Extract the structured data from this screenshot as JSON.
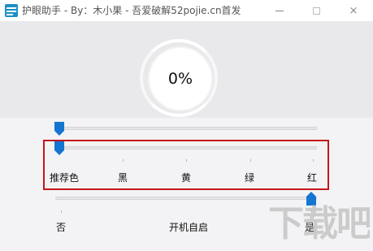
{
  "window": {
    "title": "护眼助手 - By：木小果 - 吾爱破解52pojie.cn首发",
    "minimize_icon": "minimize-icon",
    "maximize_icon": "maximize-icon",
    "close_label": "×"
  },
  "dial": {
    "value_text": "0%"
  },
  "sliders": {
    "brightness": {
      "value_fraction": 0.0
    },
    "color": {
      "options": [
        "推荐色",
        "黑",
        "黄",
        "绿",
        "红"
      ],
      "selected_index": 0
    },
    "autostart": {
      "label": "开机自启",
      "off_label": "否",
      "on_label": "是",
      "value": "是"
    }
  },
  "colors": {
    "accent": "#1476d1",
    "highlight": "#c4161c",
    "app_icon": "#1c8fc7"
  },
  "watermark": {
    "text": "下载吧"
  }
}
